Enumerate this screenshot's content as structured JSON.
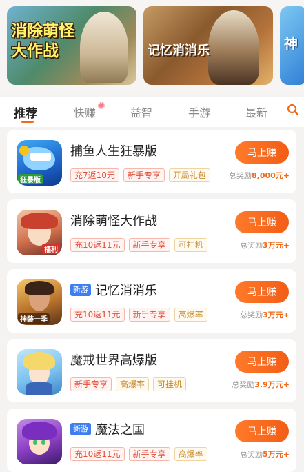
{
  "banners": [
    {
      "title": "消除萌怪大作战"
    },
    {
      "title": "记忆消消乐"
    },
    {
      "title": "神"
    }
  ],
  "tabs": [
    {
      "label": "推荐",
      "active": true
    },
    {
      "label": "快赚",
      "active": false
    },
    {
      "label": "益智",
      "active": false
    },
    {
      "label": "手游",
      "active": false
    },
    {
      "label": "最新",
      "active": false
    }
  ],
  "colors": {
    "accent": "#f26a1b",
    "tag_red": "#e0503a",
    "tag_gold": "#c88a2c",
    "new_badge": "#3f7ef0"
  },
  "games": [
    {
      "name": "捕鱼人生狂暴版",
      "is_new": false,
      "tags": [
        "充7返10元",
        "新手专享",
        "开局礼包"
      ],
      "tag_colors": [
        "red",
        "red",
        "gold"
      ],
      "button": "马上赚",
      "reward_label": "总奖励",
      "reward_amount": "8,000元+",
      "icon_text": "狂暴版"
    },
    {
      "name": "消除萌怪大作战",
      "is_new": false,
      "tags": [
        "充10返11元",
        "新手专享",
        "可挂机"
      ],
      "tag_colors": [
        "red",
        "red",
        "gold"
      ],
      "button": "马上赚",
      "reward_label": "总奖励",
      "reward_amount": "3万元+",
      "icon_text": "福利"
    },
    {
      "name": "记忆消消乐",
      "is_new": true,
      "new_label": "新游",
      "tags": [
        "充10返11元",
        "新手专享",
        "高爆率"
      ],
      "tag_colors": [
        "red",
        "red",
        "gold"
      ],
      "button": "马上赚",
      "reward_label": "总奖励",
      "reward_amount": "3万元+",
      "icon_text": "神装一季"
    },
    {
      "name": "魔戒世界高爆版",
      "is_new": false,
      "tags": [
        "新手专享",
        "高爆率",
        "可挂机"
      ],
      "tag_colors": [
        "red",
        "gold",
        "gold"
      ],
      "button": "马上赚",
      "reward_label": "总奖励",
      "reward_amount": "3.9万元+",
      "icon_text": ""
    },
    {
      "name": "魔法之国",
      "is_new": true,
      "new_label": "新游",
      "tags": [
        "充10返11元",
        "新手专享",
        "高爆率"
      ],
      "tag_colors": [
        "red",
        "red",
        "gold"
      ],
      "button": "马上赚",
      "reward_label": "总奖励",
      "reward_amount": "5万元+",
      "icon_text": ""
    }
  ]
}
